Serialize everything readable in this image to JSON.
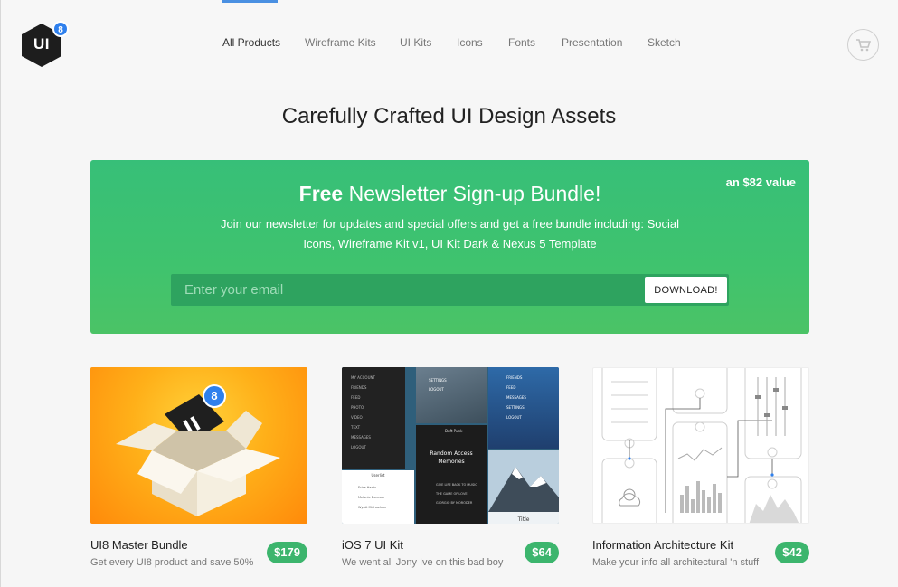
{
  "header": {
    "logo_text": "UI",
    "logo_badge": "8",
    "nav": [
      {
        "label": "All Products",
        "active": true
      },
      {
        "label": "Wireframe Kits"
      },
      {
        "label": "UI Kits"
      },
      {
        "label": "Icons"
      },
      {
        "label": "Fonts"
      },
      {
        "label": "Presentation"
      },
      {
        "label": "Sketch"
      }
    ],
    "cart_icon": "shopping-cart-icon"
  },
  "page_title": "Carefully Crafted UI Design Assets",
  "banner": {
    "value_badge": "an $82 value",
    "heading_bold": "Free",
    "heading_rest": " Newsletter Sign-up Bundle!",
    "description": "Join our newsletter for updates and special offers and get a free bundle including: Social Icons, Wireframe Kit v1, UI Kit Dark & Nexus 5 Template",
    "email_placeholder": "Enter your email",
    "download_label": "DOWNLOAD!"
  },
  "products": [
    {
      "name": "UI8 Master Bundle",
      "desc": "Get every UI8 product and save 50%",
      "price": "$179",
      "box_badge": "8"
    },
    {
      "name": "iOS 7 UI Kit",
      "desc": "We went all Jony Ive on this bad boy",
      "price": "$64",
      "menu_items": [
        "MY ACCOUNT",
        "FRIENDS",
        "FEED",
        "PHOTO",
        "VIDEO",
        "TEXT",
        "MESSAGES",
        "LOGOUT"
      ],
      "right_menu": [
        "FRIENDS",
        "FEED",
        "MESSAGES",
        "SETTINGS",
        "LOGOUT"
      ],
      "mini_labels": [
        "SETTINGS",
        "LOGOUT",
        "Daft Punk",
        "Random Access Memories",
        "Userlist",
        "Erica Harris",
        "Melanie Dorman",
        "Wyatt Michaelson",
        "GIVE LIFE BACK TO MUSIC",
        "THE GAME OF LOVE",
        "GIORGIO BY MORODER",
        "Title"
      ]
    },
    {
      "name": "Information Architecture Kit",
      "desc": "Make your info all architectural 'n stuff",
      "price": "$42"
    }
  ],
  "colors": {
    "accent_green": "#3cb56d",
    "nav_active": "#4a90e2",
    "badge_blue": "#2f80ed"
  }
}
